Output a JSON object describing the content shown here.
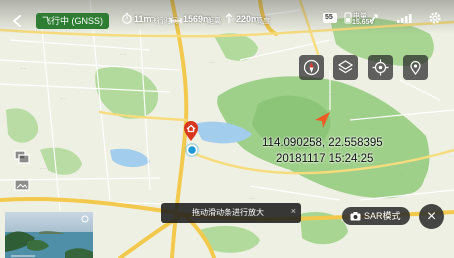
{
  "status": {
    "flight_state": "飞行中 (GNSS)",
    "flight_time_label": "飞行时间",
    "flight_time": "11m",
    "distance_label": "距离",
    "distance": "1569m",
    "altitude_label": "高度",
    "altitude": "220m",
    "satellites": "55",
    "battery_label": "电量",
    "battery": "15.65V"
  },
  "map_overlay": {
    "coordinates": "114.090258, 22.558395",
    "timestamp": "20181117 15:24:25",
    "toast": "拖动滑动条进行放大",
    "toast_close": "×",
    "sar_mode": "SAR模式",
    "close": "×"
  },
  "colors": {
    "flight_state_bg": "#2e7d32",
    "aircraft_arrow": "#ef5a22",
    "home_marker": "#d9361f",
    "drone_marker": "#1e9bd6"
  },
  "icons": [
    "back-arrow-icon",
    "timer-icon",
    "distance-icon",
    "altitude-icon",
    "satellite-icon",
    "battery-icon",
    "signal-bars-icon",
    "settings-gear-icon",
    "compass-icon",
    "layers-icon",
    "locate-target-icon",
    "location-pin-icon",
    "split-screen-icon",
    "image-gallery-icon",
    "camera-icon",
    "home-marker-icon",
    "drone-position-icon",
    "aircraft-heading-icon"
  ]
}
